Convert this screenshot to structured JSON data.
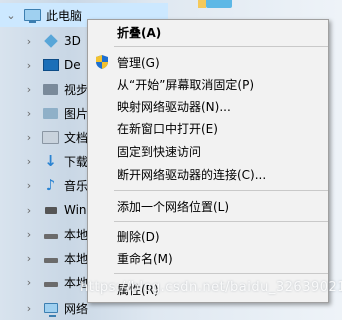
{
  "nav": {
    "items": [
      {
        "label": "此电脑",
        "icon": "computer-icon",
        "expanded": true
      },
      {
        "label": "3D",
        "icon": "3d-objects-icon"
      },
      {
        "label": "De",
        "icon": "desktop-icon"
      },
      {
        "label": "视步",
        "icon": "videos-folder-icon"
      },
      {
        "label": "图片",
        "icon": "pictures-folder-icon"
      },
      {
        "label": "文档",
        "icon": "documents-folder-icon"
      },
      {
        "label": "下载",
        "icon": "downloads-icon"
      },
      {
        "label": "音乐",
        "icon": "music-icon"
      },
      {
        "label": "Win",
        "icon": "windows-drive-icon"
      },
      {
        "label": "本地",
        "icon": "local-drive-icon"
      },
      {
        "label": "本地",
        "icon": "local-drive-icon"
      },
      {
        "label": "本地",
        "icon": "local-drive-icon"
      },
      {
        "label": "网络",
        "icon": "network-icon"
      }
    ]
  },
  "menu": {
    "collapse": "折叠(A)",
    "manage": "管理(G)",
    "unpin_start": "从“开始”屏幕取消固定(P)",
    "map_drive": "映射网络驱动器(N)...",
    "open_new_window": "在新窗口中打开(E)",
    "pin_quick_access": "固定到快速访问",
    "disconnect_drive": "断开网络驱动器的连接(C)...",
    "add_network_location": "添加一个网络位置(L)",
    "delete": "删除(D)",
    "rename": "重命名(M)",
    "properties": "属性(R)"
  },
  "watermark": "https://blog.csdn.net/baidu_32639021",
  "colors": {
    "selection": "#cce8ff",
    "menu_bg": "#f2f2f2",
    "shield_blue": "#1e6fd0",
    "shield_yellow": "#f2c230"
  }
}
